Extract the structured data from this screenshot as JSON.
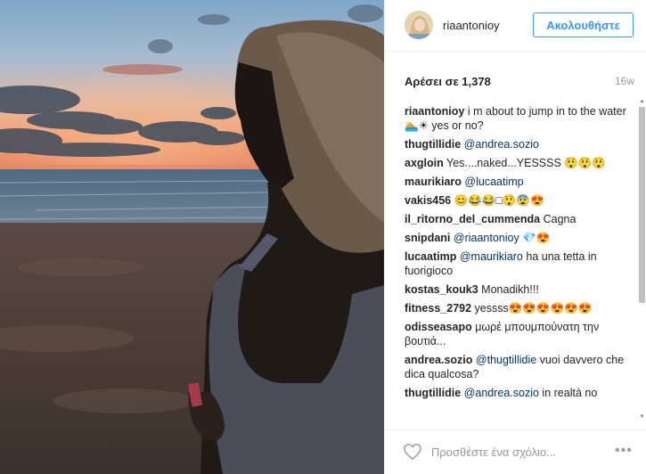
{
  "header": {
    "username": "riaantonioy",
    "follow_label": "Ακολουθήστε",
    "avatar": "profile-photo"
  },
  "stats": {
    "likes_label": "Αρέσει σε 1,378",
    "time": "16w"
  },
  "comments": [
    {
      "user": "riaantonioy",
      "text": "i m about to jump in to the water🏊☀ yes or no?"
    },
    {
      "user": "thugtillidie",
      "mention": "@andrea.sozio",
      "text": ""
    },
    {
      "user": "axgloin",
      "text": "Yes....naked...YESSSS 😲😲😲"
    },
    {
      "user": "maurikiaro",
      "mention": "@lucaatimp",
      "text": ""
    },
    {
      "user": "vakis456",
      "text": "😊😂😂□😲😨😍"
    },
    {
      "user": "il_ritorno_del_cummenda",
      "text": "Cagna"
    },
    {
      "user": "snipdani",
      "mention": "@riaantonioy",
      "text": "💎😍"
    },
    {
      "user": "lucaatimp",
      "mention": "@maurikiaro",
      "text": "ha una tetta in fuorigioco"
    },
    {
      "user": "kostas_kouk3",
      "text": "Monadikh!!!"
    },
    {
      "user": "fitness_2792",
      "text": "yessss😍😍😍😍😍😍"
    },
    {
      "user": "odisseasapo",
      "text": "μωρέ μπουμπούνατη την βουτιά..."
    },
    {
      "user": "andrea.sozio",
      "mention": "@thugtillidie",
      "text": "vuoi davvero che dica qualcosa?"
    },
    {
      "user": "thugtillidie",
      "mention": "@andrea.sozio",
      "text": "in realtà no"
    }
  ],
  "footer": {
    "comment_placeholder": "Προσθέστε ένα σχόλιο...",
    "more_label": "•••",
    "like_icon": "heart-outline-icon"
  },
  "photo": {
    "description_icon": "sunset-beach-photo"
  }
}
